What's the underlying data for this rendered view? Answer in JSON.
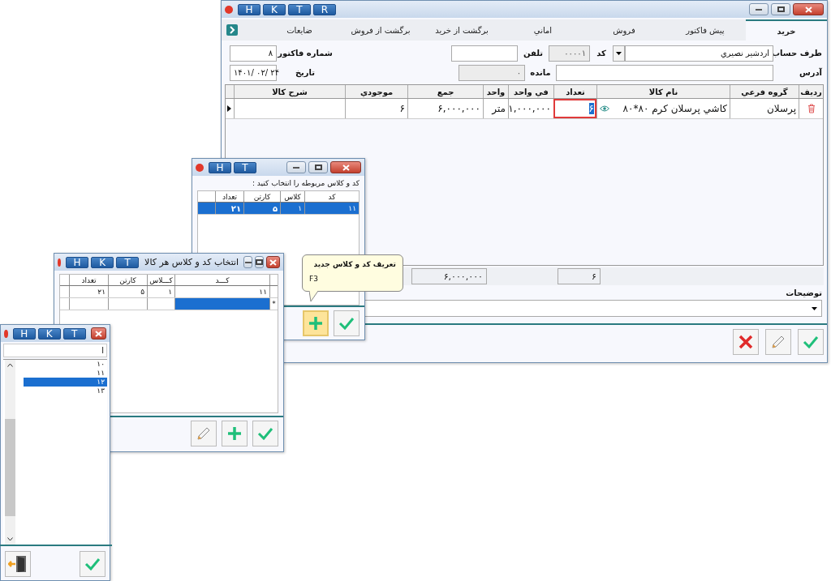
{
  "main_window": {
    "title_buttons": [
      "R",
      "T",
      "K",
      "H"
    ],
    "tabs": [
      {
        "label": "خريد",
        "selected": true
      },
      {
        "label": "پيش فاکتور",
        "selected": false
      },
      {
        "label": "فروش",
        "selected": false
      },
      {
        "label": "اماني",
        "selected": false
      },
      {
        "label": "برگشت از خريد",
        "selected": false
      },
      {
        "label": "برگشت از فروش",
        "selected": false
      },
      {
        "label": "ضايعات",
        "selected": false
      }
    ],
    "form": {
      "account_label": "طرف حساب",
      "account": "اردشير نصيري",
      "code_label": "کد",
      "code": "۰۰۰۰۱",
      "phone_label": "تلفن",
      "invoice_label": "شماره فاکتور",
      "invoice": "۸",
      "address_label": "آدرس",
      "balance_label": "مانده",
      "balance": "۰",
      "date_label": "تاریخ",
      "date": "۱۴۰۱/ ۰۲/ ۲۴"
    },
    "grid": {
      "columns": [
        "رديف",
        "گروه فرعي",
        "نام کالا",
        "تعداد",
        "في واحد",
        "واحد",
        "جمع",
        "موجودي",
        "شرح کالا"
      ],
      "rows": [
        {
          "group": "پرسلان",
          "name": "کاشي پرسلان کرم ۸۰*۸۰",
          "quantity": "۶",
          "unit_price": "۱,۰۰۰,۰۰۰",
          "unit": "متر",
          "total": "۶,۰۰۰,۰۰۰",
          "stock": "۶"
        }
      ]
    },
    "totals": {
      "quantity": "۶",
      "total": "۶,۰۰۰,۰۰۰"
    },
    "description_label": "توضيحات"
  },
  "code_window": {
    "title_buttons": [
      "T",
      "H"
    ],
    "prompt": "کد و کلاس مربوطه را انتخاب کنید :",
    "columns": [
      "کد",
      "کلاس",
      "کارتن",
      "تعداد"
    ],
    "rows": [
      {
        "cells": [
          "۱۱",
          "۱",
          "۵",
          "۲۱"
        ],
        "selected": true
      }
    ]
  },
  "tooltip": {
    "title": "تعریف کد و کلاس جدید",
    "shortcut": "F3"
  },
  "class_window": {
    "title_buttons": [
      "T",
      "K",
      "H"
    ],
    "title": "انتخاب کد و کلاس هر کالا",
    "columns": [
      "کـــد",
      "کـــلاس",
      "کارتن",
      "تعداد"
    ],
    "rows": [
      {
        "cells": [
          "۱۱",
          "۱",
          "۵",
          "۲۱"
        ],
        "selected": false
      }
    ],
    "new_row": {
      "marker": "*",
      "selected": true
    }
  },
  "list_window": {
    "title_buttons": [
      "T",
      "K",
      "H"
    ],
    "search": "ا",
    "items": [
      {
        "label": "۱۰",
        "selected": false
      },
      {
        "label": "۱۱",
        "selected": false
      },
      {
        "label": "۱۲",
        "selected": true
      },
      {
        "label": "۱۳",
        "selected": false
      }
    ]
  }
}
